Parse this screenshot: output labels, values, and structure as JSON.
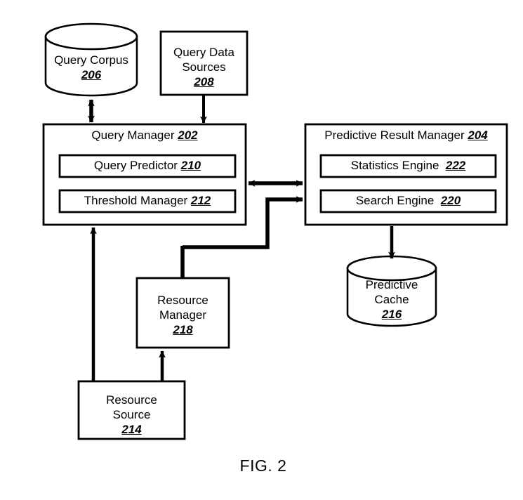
{
  "figure": {
    "caption": "FIG. 2"
  },
  "nodes": {
    "query_corpus": {
      "name": "Query Corpus",
      "ref": "206",
      "shape": "cylinder"
    },
    "query_data_sources": {
      "name_line1": "Query Data",
      "name_line2": "Sources",
      "ref": "208",
      "shape": "rectangle"
    },
    "query_manager": {
      "name": "Query Manager",
      "ref": "202",
      "shape": "rectangle"
    },
    "query_predictor": {
      "name": "Query Predictor",
      "ref": "210",
      "shape": "rectangle"
    },
    "threshold_manager": {
      "name": "Threshold Manager",
      "ref": "212",
      "shape": "rectangle"
    },
    "predictive_result_manager": {
      "name": "Predictive Result Manager",
      "ref": "204",
      "shape": "rectangle"
    },
    "statistics_engine": {
      "name": "Statistics Engine",
      "ref": "222",
      "shape": "rectangle"
    },
    "search_engine": {
      "name": "Search Engine",
      "ref": "220",
      "shape": "rectangle"
    },
    "predictive_cache": {
      "name_line1": "Predictive",
      "name_line2": "Cache",
      "ref": "216",
      "shape": "cylinder"
    },
    "resource_manager": {
      "name_line1": "Resource",
      "name_line2": "Manager",
      "ref": "218",
      "shape": "rectangle"
    },
    "resource_source": {
      "name_line1": "Resource",
      "name_line2": "Source",
      "ref": "214",
      "shape": "rectangle"
    }
  },
  "connections": [
    {
      "from": "query_corpus",
      "to": "query_manager",
      "style": "bidirectional"
    },
    {
      "from": "query_data_sources",
      "to": "query_manager",
      "style": "arrow"
    },
    {
      "from": "query_manager",
      "to": "predictive_result_manager",
      "style": "bidirectional"
    },
    {
      "from": "resource_manager",
      "to": "predictive_result_manager",
      "style": "arrow"
    },
    {
      "from": "search_engine",
      "to": "predictive_cache",
      "style": "arrow"
    },
    {
      "from": "resource_source",
      "to": "resource_manager",
      "style": "arrow"
    },
    {
      "from": "resource_source",
      "to": "query_manager",
      "style": "arrow"
    }
  ],
  "colors": {
    "stroke": "#000000",
    "fill": "#ffffff",
    "text": "#000000"
  }
}
